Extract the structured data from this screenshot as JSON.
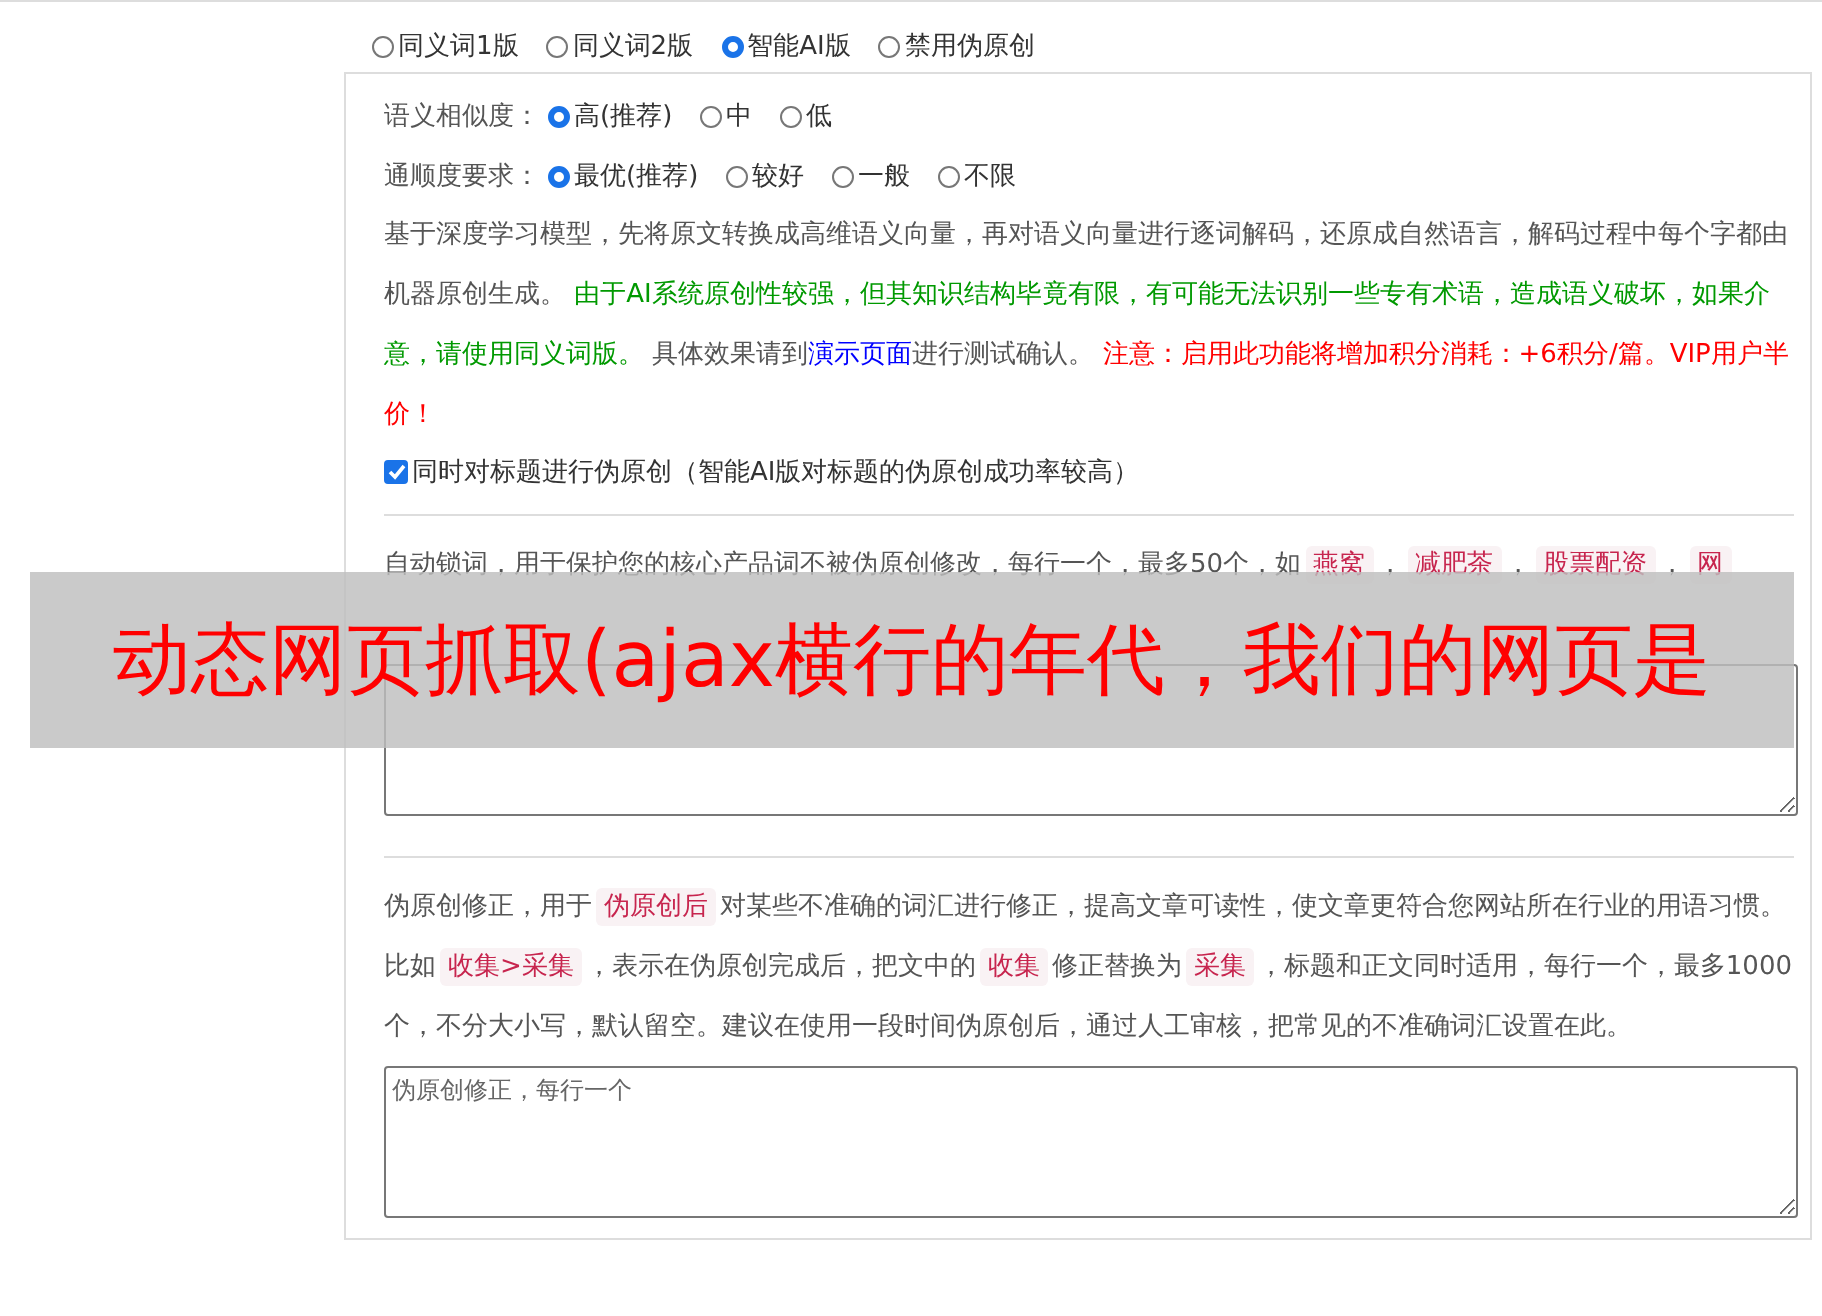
{
  "mode_options": [
    {
      "label": "同义词1版",
      "selected": false
    },
    {
      "label": "同义词2版",
      "selected": false
    },
    {
      "label": "智能AI版",
      "selected": true
    },
    {
      "label": "禁用伪原创",
      "selected": false
    }
  ],
  "similarity": {
    "label": "语义相似度：",
    "options": [
      {
        "label": "高(推荐)",
        "selected": true
      },
      {
        "label": "中",
        "selected": false
      },
      {
        "label": "低",
        "selected": false
      }
    ]
  },
  "fluency": {
    "label": "通顺度要求：",
    "options": [
      {
        "label": "最优(推荐)",
        "selected": true
      },
      {
        "label": "较好",
        "selected": false
      },
      {
        "label": "一般",
        "selected": false
      },
      {
        "label": "不限",
        "selected": false
      }
    ]
  },
  "ai_description": [
    {
      "kind": "plain",
      "text": "基于深度学习模型，先将原文转换成高维语义向量，再对语义向量进行逐词解码，还原成自然语言，解码过程中每个字都由机器原创生成。 "
    },
    {
      "kind": "green",
      "text": "由于AI系统原创性较强，但其知识结构毕竟有限，有可能无法识别一些专有术语，造成语义破坏，如果介意，请使用同义词版。"
    },
    {
      "kind": "plain",
      "text": " 具体效果请到"
    },
    {
      "kind": "link",
      "text": "演示页面"
    },
    {
      "kind": "plain",
      "text": "进行测试确认。 "
    },
    {
      "kind": "red",
      "text": "注意：启用此功能将增加积分消耗：+6积分/篇。VIP用户半价！"
    }
  ],
  "title_checkbox": {
    "label": "同时对标题进行伪原创（智能AI版对标题的伪原创成功率较高）",
    "checked": true
  },
  "lock_description": [
    {
      "kind": "plain",
      "text": "自动锁词，用于保护您的核心产品词不被伪原创修改，每行一个，最多50个，如"
    },
    {
      "kind": "code",
      "text": "燕窝"
    },
    {
      "kind": "plain",
      "text": "，"
    },
    {
      "kind": "code",
      "text": "减肥茶"
    },
    {
      "kind": "plain",
      "text": "，"
    },
    {
      "kind": "code",
      "text": "股票配资"
    },
    {
      "kind": "plain",
      "text": "，"
    },
    {
      "kind": "code",
      "text": "网"
    }
  ],
  "correction_description": [
    {
      "kind": "plain",
      "text": "伪原创修正，用于"
    },
    {
      "kind": "code",
      "text": "伪原创后"
    },
    {
      "kind": "plain",
      "text": "对某些不准确的词汇进行修正，提高文章可读性，使文章更符合您网站所在行业的用语习惯。比如"
    },
    {
      "kind": "code",
      "text": "收集>采集"
    },
    {
      "kind": "plain",
      "text": "，表示在伪原创完成后，把文中的"
    },
    {
      "kind": "code",
      "text": "收集"
    },
    {
      "kind": "plain",
      "text": "修正替换为"
    },
    {
      "kind": "code",
      "text": "采集"
    },
    {
      "kind": "plain",
      "text": "，标题和正文同时适用，每行一个，最多1000个，不分大小写，默认留空。建议在使用一段时间伪原创后，通过人工审核，把常见的不准确词汇设置在此。"
    }
  ],
  "correction_field": {
    "placeholder": "伪原创修正，每行一个"
  },
  "overlay_banner": "动态网页抓取(ajax横行的年代，我们的网页是"
}
